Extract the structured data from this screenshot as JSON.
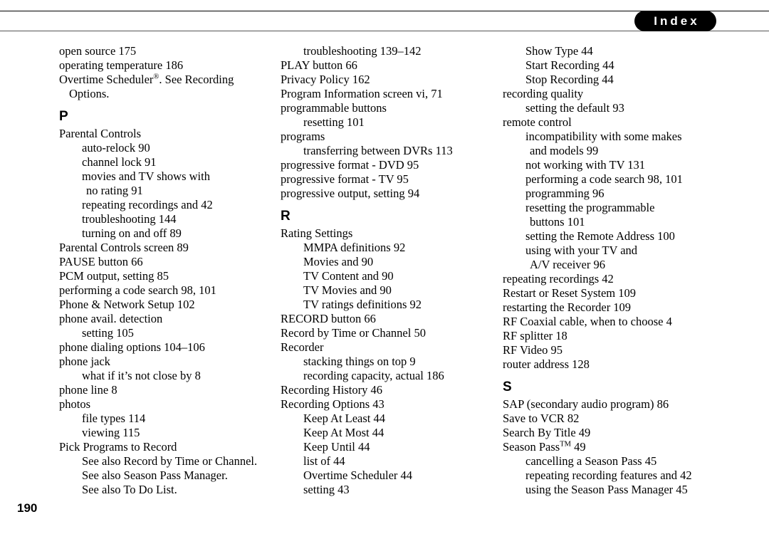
{
  "header": {
    "tab_label": "Index",
    "tab_bg_color": "#000000",
    "tab_text_color": "#ffffff",
    "rule_color": "#000000"
  },
  "footer": {
    "page_number": "190"
  },
  "columns": [
    {
      "name": "column-1",
      "entries": [
        {
          "kind": "entry",
          "level": 0,
          "text": "open source 175"
        },
        {
          "kind": "entry",
          "level": 0,
          "text": "operating temperature 186"
        },
        {
          "kind": "entry",
          "level": 0,
          "text": "Overtime Scheduler",
          "sup": "®",
          "after_sup": ". See Recording"
        },
        {
          "kind": "cont",
          "level": 0,
          "text": "Options."
        },
        {
          "kind": "heading",
          "level": 0,
          "text": "P"
        },
        {
          "kind": "entry",
          "level": 0,
          "text": "Parental Controls"
        },
        {
          "kind": "entry",
          "level": 1,
          "text": "auto-relock 90"
        },
        {
          "kind": "entry",
          "level": 1,
          "text": "channel lock 91"
        },
        {
          "kind": "entry",
          "level": 1,
          "text": "movies and TV shows with"
        },
        {
          "kind": "cont",
          "level": 1,
          "text": "no rating 91"
        },
        {
          "kind": "entry",
          "level": 1,
          "text": "repeating recordings and 42"
        },
        {
          "kind": "entry",
          "level": 1,
          "text": "troubleshooting 144"
        },
        {
          "kind": "entry",
          "level": 1,
          "text": "turning on and off 89"
        },
        {
          "kind": "entry",
          "level": 0,
          "text": "Parental Controls screen 89"
        },
        {
          "kind": "entry",
          "level": 0,
          "text": "PAUSE button 66"
        },
        {
          "kind": "entry",
          "level": 0,
          "text": "PCM output, setting 85"
        },
        {
          "kind": "entry",
          "level": 0,
          "text": "performing a code search 98, 101"
        },
        {
          "kind": "entry",
          "level": 0,
          "text": "Phone & Network Setup 102"
        },
        {
          "kind": "entry",
          "level": 0,
          "text": "phone avail. detection"
        },
        {
          "kind": "entry",
          "level": 1,
          "text": "setting 105"
        },
        {
          "kind": "entry",
          "level": 0,
          "text": "phone dialing options 104–106"
        },
        {
          "kind": "entry",
          "level": 0,
          "text": "phone jack"
        },
        {
          "kind": "entry",
          "level": 1,
          "text": "what if it’s not close by 8"
        },
        {
          "kind": "entry",
          "level": 0,
          "text": "phone line 8"
        },
        {
          "kind": "entry",
          "level": 0,
          "text": "photos"
        },
        {
          "kind": "entry",
          "level": 1,
          "text": "file types 114"
        },
        {
          "kind": "entry",
          "level": 1,
          "text": "viewing 115"
        },
        {
          "kind": "entry",
          "level": 0,
          "text": "Pick Programs to Record"
        },
        {
          "kind": "entry",
          "level": 1,
          "text": "See also Record by Time or Channel."
        },
        {
          "kind": "entry",
          "level": 1,
          "text": "See also Season Pass Manager."
        },
        {
          "kind": "entry",
          "level": 1,
          "text": "See also To Do List."
        }
      ]
    },
    {
      "name": "column-2",
      "entries": [
        {
          "kind": "entry",
          "level": 1,
          "text": "troubleshooting 139–142"
        },
        {
          "kind": "entry",
          "level": 0,
          "text": "PLAY button 66"
        },
        {
          "kind": "entry",
          "level": 0,
          "text": "Privacy Policy 162"
        },
        {
          "kind": "entry",
          "level": 0,
          "text": "Program Information screen vi, 71"
        },
        {
          "kind": "entry",
          "level": 0,
          "text": "programmable buttons"
        },
        {
          "kind": "entry",
          "level": 1,
          "text": "resetting 101"
        },
        {
          "kind": "entry",
          "level": 0,
          "text": "programs"
        },
        {
          "kind": "entry",
          "level": 1,
          "text": "transferring between DVRs 113"
        },
        {
          "kind": "entry",
          "level": 0,
          "text": "progressive format - DVD 95"
        },
        {
          "kind": "entry",
          "level": 0,
          "text": "progressive format - TV 95"
        },
        {
          "kind": "entry",
          "level": 0,
          "text": "progressive output, setting 94"
        },
        {
          "kind": "heading",
          "level": 0,
          "text": "R"
        },
        {
          "kind": "entry",
          "level": 0,
          "text": "Rating Settings"
        },
        {
          "kind": "entry",
          "level": 1,
          "text": "MMPA definitions 92"
        },
        {
          "kind": "entry",
          "level": 1,
          "text": "Movies and 90"
        },
        {
          "kind": "entry",
          "level": 1,
          "text": "TV Content and 90"
        },
        {
          "kind": "entry",
          "level": 1,
          "text": "TV Movies and 90"
        },
        {
          "kind": "entry",
          "level": 1,
          "text": "TV ratings definitions 92"
        },
        {
          "kind": "entry",
          "level": 0,
          "text": "RECORD button 66"
        },
        {
          "kind": "entry",
          "level": 0,
          "text": "Record by Time or Channel 50"
        },
        {
          "kind": "entry",
          "level": 0,
          "text": "Recorder"
        },
        {
          "kind": "entry",
          "level": 1,
          "text": "stacking things on top 9"
        },
        {
          "kind": "entry",
          "level": 1,
          "text": "recording capacity, actual 186"
        },
        {
          "kind": "entry",
          "level": 0,
          "text": "Recording History 46"
        },
        {
          "kind": "entry",
          "level": 0,
          "text": "Recording Options 43"
        },
        {
          "kind": "entry",
          "level": 1,
          "text": "Keep At Least 44"
        },
        {
          "kind": "entry",
          "level": 1,
          "text": "Keep At Most 44"
        },
        {
          "kind": "entry",
          "level": 1,
          "text": "Keep Until 44"
        },
        {
          "kind": "entry",
          "level": 1,
          "text": "list of 44"
        },
        {
          "kind": "entry",
          "level": 1,
          "text": "Overtime Scheduler 44"
        },
        {
          "kind": "entry",
          "level": 1,
          "text": "setting 43"
        }
      ]
    },
    {
      "name": "column-3",
      "entries": [
        {
          "kind": "entry",
          "level": 1,
          "text": "Show Type 44"
        },
        {
          "kind": "entry",
          "level": 1,
          "text": "Start Recording 44"
        },
        {
          "kind": "entry",
          "level": 1,
          "text": "Stop Recording 44"
        },
        {
          "kind": "entry",
          "level": 0,
          "text": "recording quality"
        },
        {
          "kind": "entry",
          "level": 1,
          "text": "setting the default 93"
        },
        {
          "kind": "entry",
          "level": 0,
          "text": "remote control"
        },
        {
          "kind": "entry",
          "level": 1,
          "text": "incompatibility with some makes"
        },
        {
          "kind": "cont",
          "level": 1,
          "text": "and models 99"
        },
        {
          "kind": "entry",
          "level": 1,
          "text": "not working with TV 131"
        },
        {
          "kind": "entry",
          "level": 1,
          "text": "performing a code search 98, 101"
        },
        {
          "kind": "entry",
          "level": 1,
          "text": "programming 96"
        },
        {
          "kind": "entry",
          "level": 1,
          "text": "resetting the programmable"
        },
        {
          "kind": "cont",
          "level": 1,
          "text": "buttons 101"
        },
        {
          "kind": "entry",
          "level": 1,
          "text": "setting the Remote Address 100"
        },
        {
          "kind": "entry",
          "level": 1,
          "text": "using with your TV and"
        },
        {
          "kind": "cont",
          "level": 1,
          "text": "A/V receiver 96"
        },
        {
          "kind": "entry",
          "level": 0,
          "text": "repeating recordings 42"
        },
        {
          "kind": "entry",
          "level": 0,
          "text": "Restart or Reset System 109"
        },
        {
          "kind": "entry",
          "level": 0,
          "text": "restarting the Recorder 109"
        },
        {
          "kind": "entry",
          "level": 0,
          "text": "RF Coaxial cable, when to choose 4"
        },
        {
          "kind": "entry",
          "level": 0,
          "text": "RF splitter 18"
        },
        {
          "kind": "entry",
          "level": 0,
          "text": "RF Video 95"
        },
        {
          "kind": "entry",
          "level": 0,
          "text": "router address 128"
        },
        {
          "kind": "heading",
          "level": 0,
          "text": "S"
        },
        {
          "kind": "entry",
          "level": 0,
          "text": "SAP (secondary audio program) 86"
        },
        {
          "kind": "entry",
          "level": 0,
          "text": "Save to VCR 82"
        },
        {
          "kind": "entry",
          "level": 0,
          "text": "Search By Title 49"
        },
        {
          "kind": "entry",
          "level": 0,
          "text": "Season Pass",
          "sup": "TM",
          "after_sup": " 49"
        },
        {
          "kind": "entry",
          "level": 1,
          "text": "cancelling a Season Pass 45"
        },
        {
          "kind": "entry",
          "level": 1,
          "text": "repeating recording features and 42"
        },
        {
          "kind": "entry",
          "level": 1,
          "text": "using the Season Pass Manager 45"
        }
      ]
    }
  ]
}
